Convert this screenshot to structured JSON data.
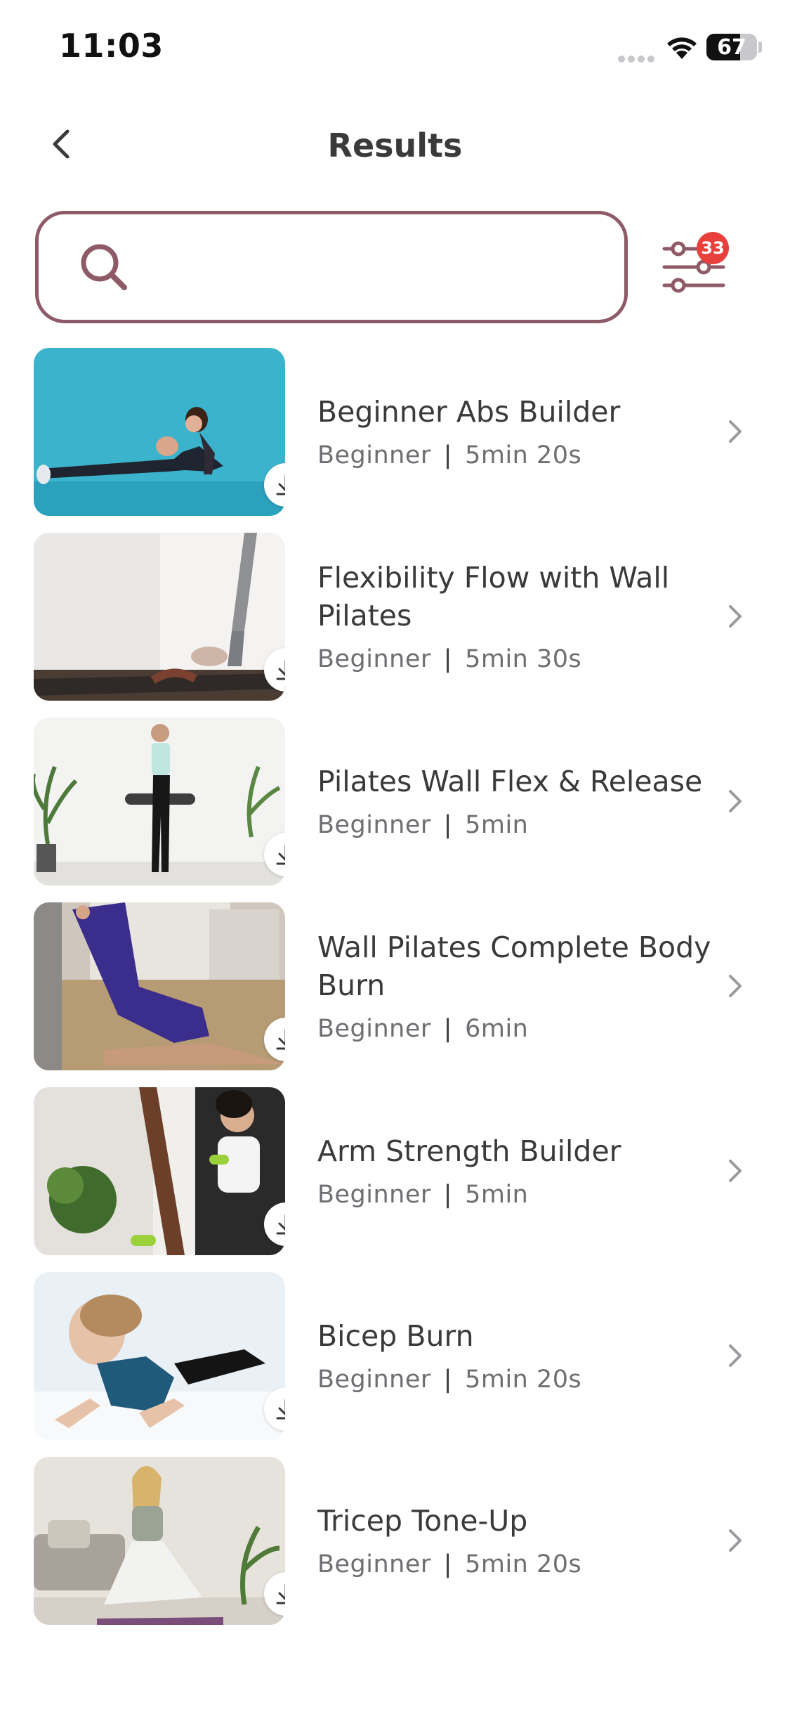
{
  "status_bar": {
    "time": "11:03",
    "battery": "67",
    "battery_level": 0.67
  },
  "header": {
    "title": "Results",
    "back_icon": "chevron-left-icon"
  },
  "search": {
    "value": "",
    "placeholder": "",
    "icon": "search-icon"
  },
  "filter": {
    "icon": "sliders-icon",
    "badge_count": "33"
  },
  "workouts": [
    {
      "title": "Beginner Abs Builder",
      "level": "Beginner",
      "duration": "5min 20s"
    },
    {
      "title": "Flexibility Flow with Wall Pilates",
      "level": "Beginner",
      "duration": "5min 30s"
    },
    {
      "title": "Pilates Wall Flex & Release",
      "level": "Beginner",
      "duration": "5min"
    },
    {
      "title": "Wall Pilates Complete Body Burn",
      "level": "Beginner",
      "duration": "6min"
    },
    {
      "title": "Arm Strength Builder",
      "level": "Beginner",
      "duration": "5min"
    },
    {
      "title": "Bicep Burn",
      "level": "Beginner",
      "duration": "5min 20s"
    },
    {
      "title": "Tricep Tone-Up",
      "level": "Beginner",
      "duration": "5min 20s"
    }
  ],
  "meta_separator": "|",
  "colors": {
    "accent": "#8f5a67",
    "badge": "#e8403a",
    "title_text": "#3a3a3c",
    "meta_text": "#6e6e73"
  }
}
